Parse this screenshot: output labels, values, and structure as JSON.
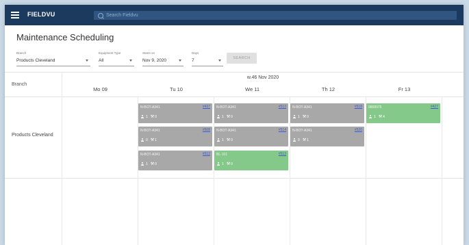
{
  "app": {
    "brand": "FIELDVU",
    "search_placeholder": "Search Fieldvu"
  },
  "page": {
    "title": "Maintenance Scheduling"
  },
  "filters": {
    "branch": {
      "label": "Branch",
      "value": "Products Cleveland"
    },
    "equipment_type": {
      "label": "Equipment Type",
      "value": "All"
    },
    "starts_on": {
      "label": "Starts on",
      "value": "Nov 9, 2020"
    },
    "days": {
      "label": "Days",
      "value": "7"
    },
    "search_button": "SEARCH"
  },
  "grid": {
    "branch_header": "Branch",
    "week_label": "w.46 Nov 2020",
    "days": [
      "Mo 09",
      "Tu 10",
      "We 11",
      "Th 12",
      "Fr 13"
    ],
    "row_branch": "Products Cleveland"
  },
  "cards": [
    {
      "name": "N-BOT-A341",
      "num": "#437",
      "people": "1",
      "tools": "0",
      "status": "gray"
    },
    {
      "name": "N-BOT-A341",
      "num": "#513",
      "people": "1",
      "tools": "0",
      "status": "gray"
    },
    {
      "name": "N-BOT-A341",
      "num": "#518",
      "people": "1",
      "tools": "0",
      "status": "gray"
    },
    {
      "name": "9868975",
      "num": "#427",
      "people": "1",
      "tools": "4",
      "status": "green"
    },
    {
      "name": "N-BOT-A341",
      "num": "#508",
      "people": "0",
      "tools": "1",
      "status": "gray"
    },
    {
      "name": "N-BOT-A341",
      "num": "#514",
      "people": "1",
      "tools": "0",
      "status": "gray"
    },
    {
      "name": "N-BOT-A341",
      "num": "#520",
      "people": "0",
      "tools": "1",
      "status": "gray"
    },
    {
      "name": "N-BOT-A341",
      "num": "#512",
      "people": "1",
      "tools": "0",
      "status": "gray"
    },
    {
      "name": "BL-101",
      "num": "#513",
      "people": "1",
      "tools": "0",
      "status": "green"
    }
  ],
  "colors": {
    "topbar": "#1c3a5e",
    "card_gray": "#a8a8a8",
    "card_green": "#84c98a",
    "link": "#3b5bd0"
  }
}
